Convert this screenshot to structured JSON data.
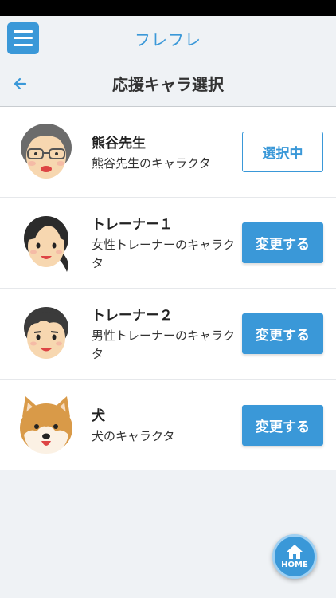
{
  "app": {
    "title": "フレフレ"
  },
  "page": {
    "title": "応援キャラ選択"
  },
  "characters": [
    {
      "name": "熊谷先生",
      "description": "熊谷先生のキャラクタ",
      "button_label": "選択中",
      "selected": true,
      "avatar_icon": "teacher-avatar-icon"
    },
    {
      "name": "トレーナー１",
      "description": "女性トレーナーのキャラクタ",
      "button_label": "変更する",
      "selected": false,
      "avatar_icon": "female-trainer-avatar-icon"
    },
    {
      "name": "トレーナー２",
      "description": "男性トレーナーのキャラクタ",
      "button_label": "変更する",
      "selected": false,
      "avatar_icon": "male-trainer-avatar-icon"
    },
    {
      "name": "犬",
      "description": "犬のキャラクタ",
      "button_label": "変更する",
      "selected": false,
      "avatar_icon": "dog-avatar-icon"
    }
  ],
  "fab": {
    "label": "HOME"
  },
  "colors": {
    "accent": "#3a98d8",
    "background": "#eff2f5",
    "text": "#333333"
  }
}
